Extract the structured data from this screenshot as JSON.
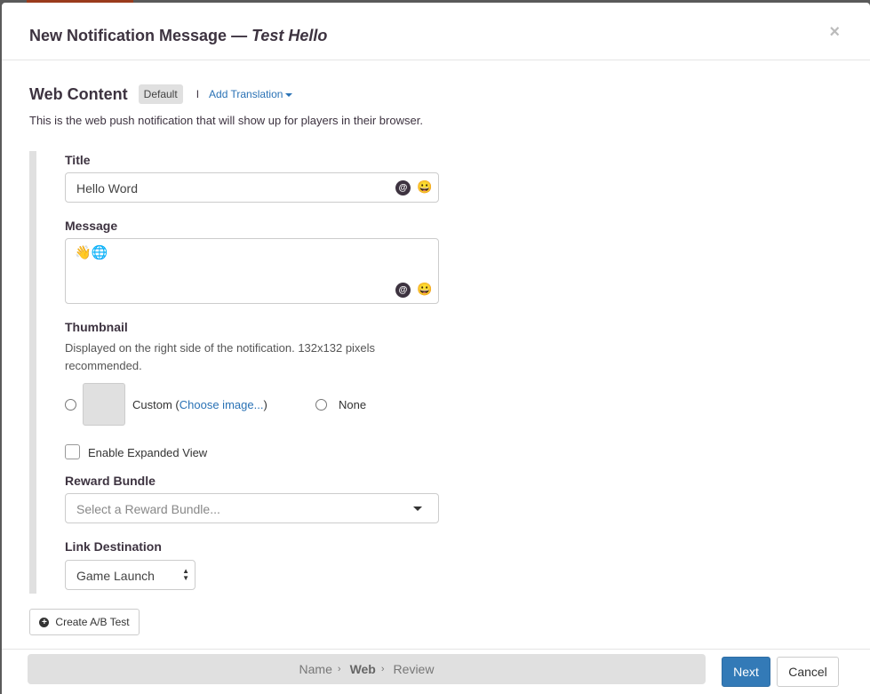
{
  "modal": {
    "title": "New Notification Message",
    "title_sep": "—",
    "campaign_name": "Test Hello",
    "close": "×"
  },
  "section": {
    "heading": "Web Content",
    "badge": "Default",
    "separator": "I",
    "add_translation": "Add Translation",
    "description": "This is the web push notification that will show up for players in their browser."
  },
  "form": {
    "title_label": "Title",
    "title_value": "Hello Word",
    "message_label": "Message",
    "message_value": "👋🌐",
    "mention_icon": "@",
    "emoji_icon": "😀",
    "thumbnail_label": "Thumbnail",
    "thumbnail_help": "Displayed on the right side of the notification. 132x132 pixels recommended.",
    "custom_label": "Custom",
    "choose_open": "(",
    "choose_image": "Choose image...",
    "choose_close": ")",
    "none_label": "None",
    "expanded_label": "Enable Expanded View",
    "reward_label": "Reward Bundle",
    "reward_placeholder": "Select a Reward Bundle...",
    "link_label": "Link Destination",
    "link_value": "Game Launch"
  },
  "ab_test": "Create A/B Test",
  "footer": {
    "steps": [
      {
        "label": "Name"
      },
      {
        "label": "Web",
        "active": true
      },
      {
        "label": "Review"
      }
    ],
    "chevron": "›",
    "next": "Next",
    "cancel": "Cancel"
  },
  "colors": {
    "primary": "#337ab7",
    "link": "#2a72b5"
  }
}
